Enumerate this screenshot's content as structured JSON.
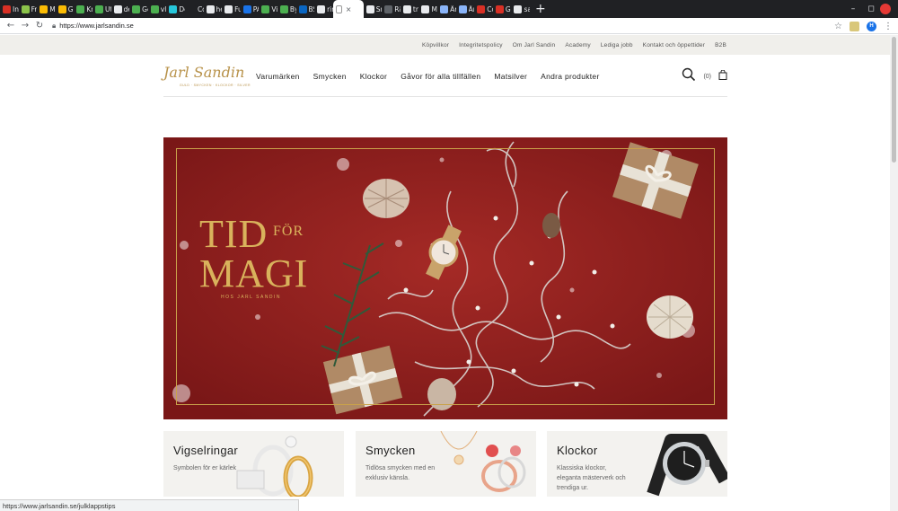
{
  "browser": {
    "tabs": [
      {
        "title": "In",
        "color": "#d93025"
      },
      {
        "title": "Fr",
        "color": "#8bc34a"
      },
      {
        "title": "My",
        "color": "#fbbc04"
      },
      {
        "title": "Go",
        "color": "#fbbc04"
      },
      {
        "title": "Kn",
        "color": "#4caf50"
      },
      {
        "title": "Ut",
        "color": "#4caf50"
      },
      {
        "title": "de",
        "color": "#e8eaed"
      },
      {
        "title": "Ge",
        "color": "#4caf50"
      },
      {
        "title": "vl.",
        "color": "#4caf50"
      },
      {
        "title": "De",
        "color": "#26c6da"
      },
      {
        "title": "Co",
        "color": "#202124"
      },
      {
        "title": "he",
        "color": "#e8eaed"
      },
      {
        "title": "Fu",
        "color": "#e8eaed"
      },
      {
        "title": "PA",
        "color": "#1a73e8"
      },
      {
        "title": "Vi",
        "color": "#4caf50"
      },
      {
        "title": "By",
        "color": "#4caf50"
      },
      {
        "title": "BS",
        "color": "#0a66c2"
      },
      {
        "title": "rin",
        "color": "#e8eaed"
      }
    ],
    "active_tab": {
      "title": "",
      "close": "×"
    },
    "tabs_after": [
      {
        "title": "Sn",
        "color": "#e8eaed"
      },
      {
        "title": "Rä",
        "color": "#5f6368"
      },
      {
        "title": "tra",
        "color": "#e8eaed"
      },
      {
        "title": "Ma",
        "color": "#e8eaed"
      },
      {
        "title": "Är",
        "color": "#8ab4f8"
      },
      {
        "title": "Är",
        "color": "#8ab4f8"
      },
      {
        "title": "Co",
        "color": "#d93025"
      },
      {
        "title": "Go",
        "color": "#d93025"
      },
      {
        "title": "sa",
        "color": "#e8eaed"
      }
    ],
    "new_tab": "+",
    "window": {
      "minimize": "–",
      "maximize": "◻"
    },
    "url": "https://www.jarlsandin.se",
    "profile_initial": "H",
    "status_url": "https://www.jarlsandin.se/julklappstips"
  },
  "util_links": [
    "Köpvillkor",
    "Integritetspolicy",
    "Om Jarl Sandin",
    "Academy",
    "Lediga jobb",
    "Kontakt och öppettider",
    "B2B"
  ],
  "logo": {
    "text": "Jarl Sandin",
    "tagline": "GULD · SMYCKEN · KLOCKOR · SILVER"
  },
  "nav": [
    "Varumärken",
    "Smycken",
    "Klockor",
    "Gåvor för alla tillfällen",
    "Matsilver",
    "Andra produkter"
  ],
  "cart": {
    "count": "(0)"
  },
  "hero": {
    "line1": "TID",
    "for": "FÖR",
    "line2": "MAGI",
    "sub": "HOS JARL SANDIN"
  },
  "cards": [
    {
      "title": "Vigselringar",
      "desc": "Symbolen för er kärlek"
    },
    {
      "title": "Smycken",
      "desc": "Tidlösa smycken med en exklusiv känsla."
    },
    {
      "title": "Klockor",
      "desc": "Klassiska klockor, eleganta mästerverk och trendiga ur."
    }
  ],
  "colors": {
    "hero_bg": "#8e1f1f",
    "gold": "#d9b25c",
    "util_bg": "#f0efeb"
  }
}
